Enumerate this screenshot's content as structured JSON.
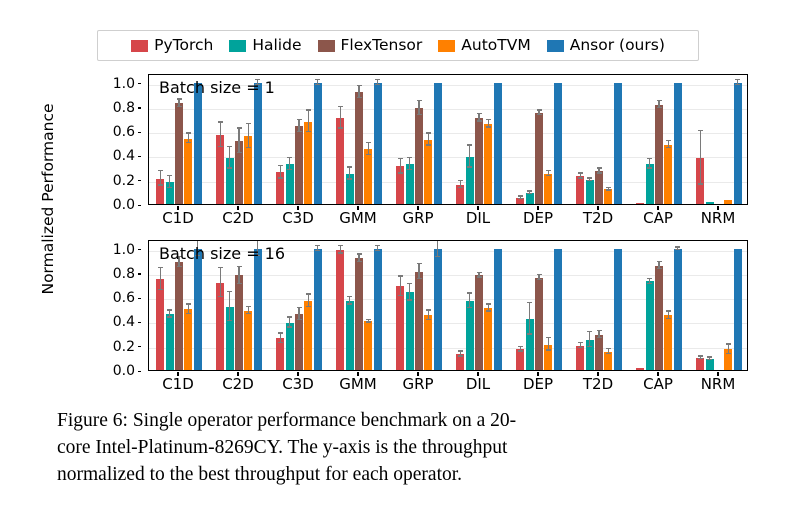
{
  "figure": {
    "caption_lines": [
      "Figure 6: Single operator performance benchmark on a 20-",
      "core Intel-Platinum-8269CY. The y-axis is the throughput",
      "normalized to the best throughput for each operator."
    ],
    "ylabel": "Normalized Performance"
  },
  "legend": {
    "position": "above-axes",
    "items": [
      {
        "label": "PyTorch",
        "color": "#d6464a"
      },
      {
        "label": "Halide",
        "color": "#00a39b"
      },
      {
        "label": "FlexTensor",
        "color": "#8c564b"
      },
      {
        "label": "AutoTVM",
        "color": "#ff8000"
      },
      {
        "label": "Ansor (ours)",
        "color": "#1f77b4"
      }
    ]
  },
  "chart_data": [
    {
      "type": "bar",
      "title": "Batch size = 1",
      "xlabel": "",
      "ylabel": "Normalized Performance",
      "ylim": [
        0.0,
        1.08
      ],
      "yticks": [
        "0.0",
        "0.2",
        "0.4",
        "0.6",
        "0.8",
        "1.0"
      ],
      "ytick_values": [
        0.0,
        0.2,
        0.4,
        0.6,
        0.8,
        1.0
      ],
      "grid": true,
      "categories": [
        "C1D",
        "C2D",
        "C3D",
        "GMM",
        "GRP",
        "DIL",
        "DEP",
        "T2D",
        "CAP",
        "NRM"
      ],
      "series": [
        {
          "name": "PyTorch",
          "color": "#d6464a",
          "values": [
            0.21,
            0.57,
            0.26,
            0.71,
            0.31,
            0.16,
            0.05,
            0.23,
            0.005,
            0.38
          ],
          "errors": [
            0.06,
            0.1,
            0.05,
            0.09,
            0.06,
            0.03,
            0.01,
            0.02,
            0.0,
            0.22
          ]
        },
        {
          "name": "Halide",
          "color": "#00a39b",
          "values": [
            0.18,
            0.38,
            0.33,
            0.25,
            0.33,
            0.39,
            0.09,
            0.2,
            0.33,
            0.02
          ],
          "errors": [
            0.05,
            0.09,
            0.05,
            0.05,
            0.05,
            0.09,
            0.01,
            0.01,
            0.04,
            0.0
          ]
        },
        {
          "name": "FlexTensor",
          "color": "#8c564b",
          "values": [
            0.83,
            0.52,
            0.64,
            0.92,
            0.79,
            0.71,
            0.75,
            0.27,
            0.82,
            0.0
          ],
          "errors": [
            0.03,
            0.1,
            0.05,
            0.05,
            0.06,
            0.03,
            0.02,
            0.02,
            0.03,
            0.0
          ]
        },
        {
          "name": "AutoTVM",
          "color": "#ff8000",
          "values": [
            0.54,
            0.56,
            0.68,
            0.45,
            0.53,
            0.66,
            0.25,
            0.12,
            0.49,
            0.03
          ],
          "errors": [
            0.04,
            0.1,
            0.09,
            0.05,
            0.05,
            0.03,
            0.02,
            0.01,
            0.03,
            0.0
          ]
        },
        {
          "name": "Ansor (ours)",
          "color": "#1f77b4",
          "values": [
            1.0,
            1.0,
            1.0,
            1.0,
            1.0,
            1.0,
            1.0,
            1.0,
            1.0,
            1.0
          ],
          "errors": [
            0.0,
            0.02,
            0.02,
            0.02,
            0.0,
            0.0,
            0.0,
            0.0,
            0.0,
            0.02
          ]
        }
      ]
    },
    {
      "type": "bar",
      "title": "Batch size = 16",
      "xlabel": "",
      "ylabel": "Normalized Performance",
      "ylim": [
        0.0,
        1.08
      ],
      "yticks": [
        "0.0",
        "0.2",
        "0.4",
        "0.6",
        "0.8",
        "1.0"
      ],
      "ytick_values": [
        0.0,
        0.2,
        0.4,
        0.6,
        0.8,
        1.0
      ],
      "grid": true,
      "categories": [
        "C1D",
        "C2D",
        "C3D",
        "GMM",
        "GRP",
        "DIL",
        "DEP",
        "T2D",
        "CAP",
        "NRM"
      ],
      "series": [
        {
          "name": "PyTorch",
          "color": "#d6464a",
          "values": [
            0.75,
            0.72,
            0.26,
            0.99,
            0.69,
            0.13,
            0.17,
            0.2,
            0.02,
            0.1
          ],
          "errors": [
            0.09,
            0.12,
            0.04,
            0.03,
            0.08,
            0.02,
            0.02,
            0.02,
            0.0,
            0.01
          ]
        },
        {
          "name": "Halide",
          "color": "#00a39b",
          "values": [
            0.46,
            0.52,
            0.39,
            0.57,
            0.64,
            0.57,
            0.42,
            0.25,
            0.73,
            0.09
          ],
          "errors": [
            0.03,
            0.12,
            0.04,
            0.03,
            0.07,
            0.06,
            0.13,
            0.06,
            0.02,
            0.01
          ]
        },
        {
          "name": "FlexTensor",
          "color": "#8c564b",
          "values": [
            0.89,
            0.78,
            0.46,
            0.92,
            0.81,
            0.78,
            0.76,
            0.29,
            0.86,
            0.0
          ],
          "errors": [
            0.04,
            0.07,
            0.05,
            0.03,
            0.06,
            0.02,
            0.02,
            0.03,
            0.03,
            0.0
          ]
        },
        {
          "name": "AutoTVM",
          "color": "#ff8000",
          "values": [
            0.5,
            0.49,
            0.57,
            0.4,
            0.45,
            0.51,
            0.21,
            0.15,
            0.45,
            0.17
          ],
          "errors": [
            0.04,
            0.03,
            0.05,
            0.01,
            0.04,
            0.03,
            0.05,
            0.02,
            0.03,
            0.04
          ]
        },
        {
          "name": "Ansor (ours)",
          "color": "#1f77b4",
          "values": [
            1.0,
            1.0,
            1.0,
            1.0,
            1.0,
            1.0,
            1.0,
            1.0,
            1.0,
            1.0
          ],
          "errors": [
            0.06,
            0.06,
            0.02,
            0.02,
            0.07,
            0.0,
            0.0,
            0.0,
            0.01,
            0.0
          ]
        }
      ]
    }
  ]
}
